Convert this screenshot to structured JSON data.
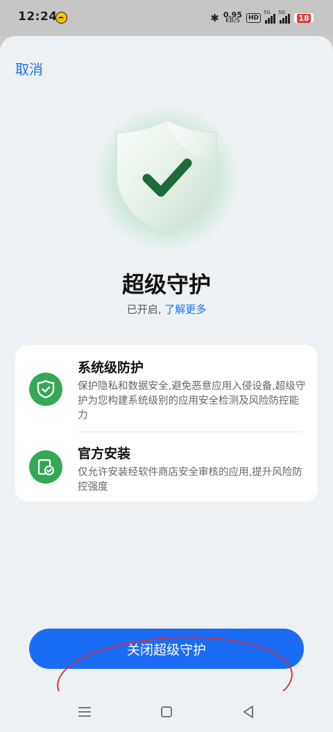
{
  "status_bar": {
    "time": "12:24",
    "net_speed_value": "0.95",
    "net_speed_unit": "KB/S",
    "hd_label": "HD",
    "sig1_label": "5G",
    "sig2_label": "5G",
    "battery_level": "18"
  },
  "header": {
    "cancel_label": "取消"
  },
  "hero": {
    "title": "超级守护",
    "status_text": "已开启,",
    "learn_more": "了解更多"
  },
  "features": [
    {
      "title": "系统级防护",
      "description": "保护隐私和数据安全,避免恶意应用入侵设备,超级守护为您构建系统级别的应用安全检测及风险防控能力",
      "icon": "shield-check-icon"
    },
    {
      "title": "官方安装",
      "description": "仅允许安装经软件商店安全审核的应用,提升风险防控强度",
      "icon": "install-check-icon"
    }
  ],
  "actions": {
    "turn_off_label": "关闭超级守护"
  },
  "colors": {
    "accent_blue": "#1b6cf5",
    "link_blue": "#1a73e8",
    "feature_green": "#34a853",
    "annotation_red": "#d3303a"
  }
}
